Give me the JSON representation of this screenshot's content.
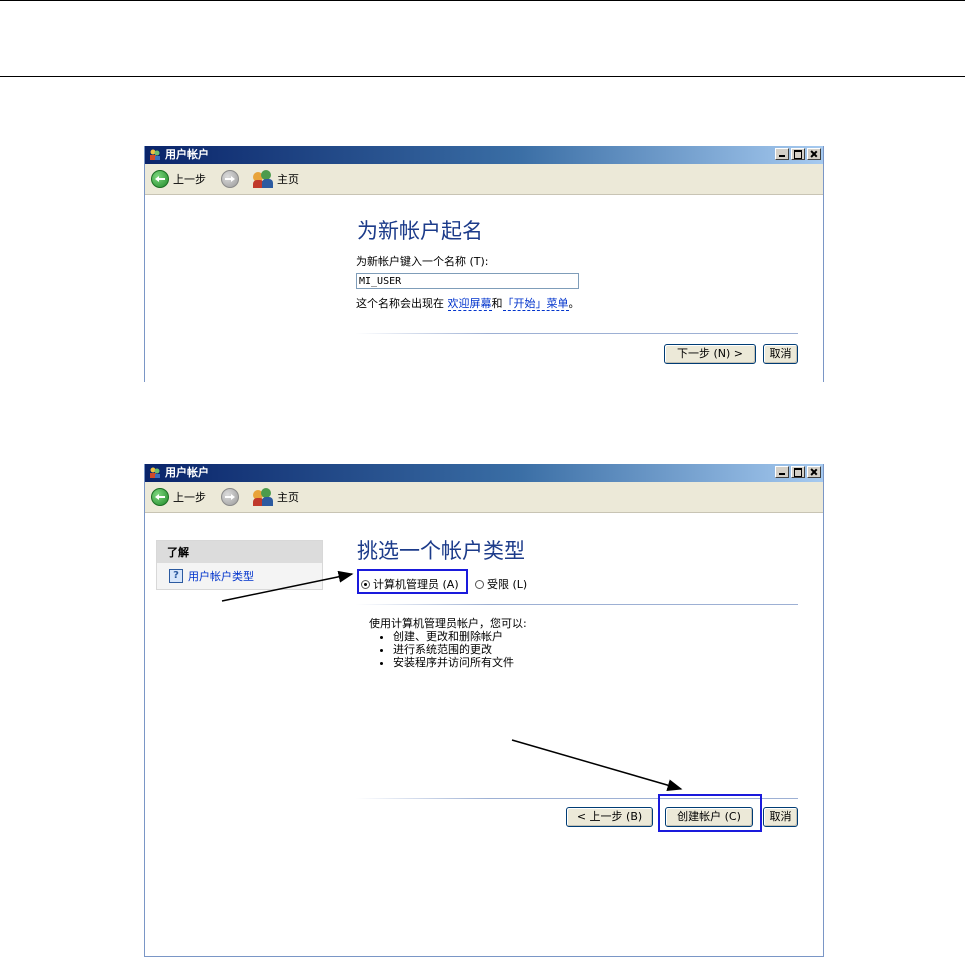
{
  "window_title": "用户帐户",
  "toolbar": {
    "back_label": "上一步",
    "home_label": "主页"
  },
  "step1": {
    "heading": "为新帐户起名",
    "prompt": "为新帐户键入一个名称 (T):",
    "name_value": "MI_USER",
    "note_prefix": "这个名称会出现在",
    "note_link1": "欢迎屏幕",
    "note_mid": "和",
    "note_link2": "「开始」菜单",
    "note_suffix": "。",
    "next_button": "下一步 (N) >",
    "cancel_button": "取消"
  },
  "step2": {
    "sidebar_header": "了解",
    "sidebar_link": "用户帐户类型",
    "heading": "挑选一个帐户类型",
    "radio_admin": "计算机管理员 (A)",
    "radio_limited": "受限 (L)",
    "radio_admin_selected": true,
    "description_intro": "使用计算机管理员帐户，您可以:",
    "description_items": [
      "创建、更改和删除帐户",
      "进行系统范围的更改",
      "安装程序并访问所有文件"
    ],
    "back_button": "< 上一步 (B)",
    "create_button": "创建帐户 (C)",
    "cancel_button": "取消"
  },
  "colors": {
    "highlight_box": "#1a1adc",
    "annotation_arrow": "#000000",
    "heading": "#1c3b8a"
  }
}
